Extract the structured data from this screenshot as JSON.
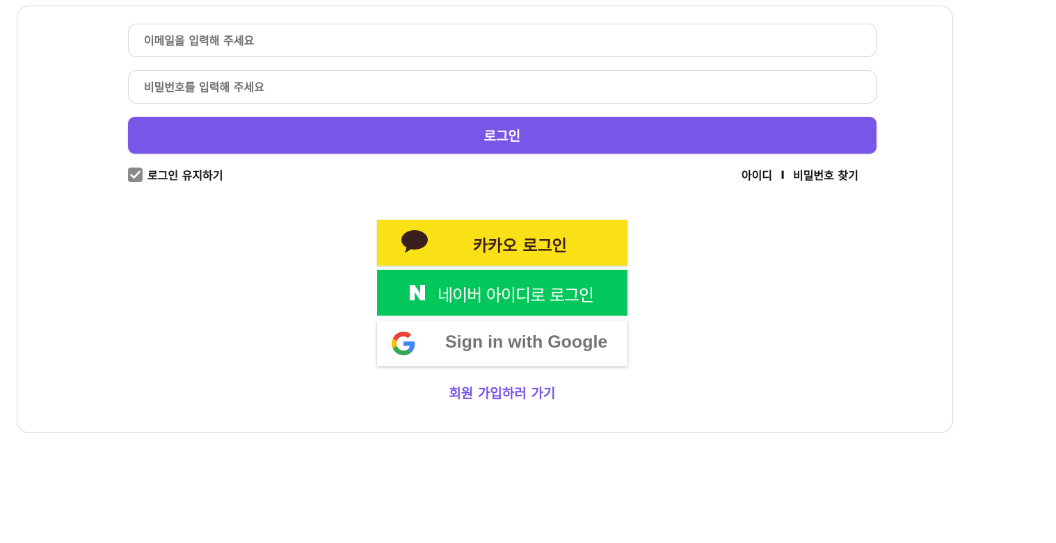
{
  "form": {
    "email": {
      "placeholder": "이메일을 입력해 주세요",
      "value": ""
    },
    "password": {
      "placeholder": "비밀번호를 입력해 주세요",
      "value": ""
    },
    "login_label": "로그인",
    "keep_login_label": "로그인 유지하기",
    "keep_login_checked": true,
    "find_id_label": "아이디",
    "separator": "I",
    "find_password_label": "비밀번호 찾기"
  },
  "social": {
    "kakao_label": "카카오 로그인",
    "naver_label": "네이버 아이디로 로그인",
    "google_label": "Sign in with Google"
  },
  "signup_label": "회원 가입하러 가기",
  "colors": {
    "accent": "#7857e8",
    "kakao": "#f9e116",
    "naver": "#03c75a",
    "checkbox": "#8a8a8a"
  },
  "icons": [
    "check-icon",
    "kakao-speech-bubble-icon",
    "naver-n-icon",
    "google-g-icon"
  ]
}
